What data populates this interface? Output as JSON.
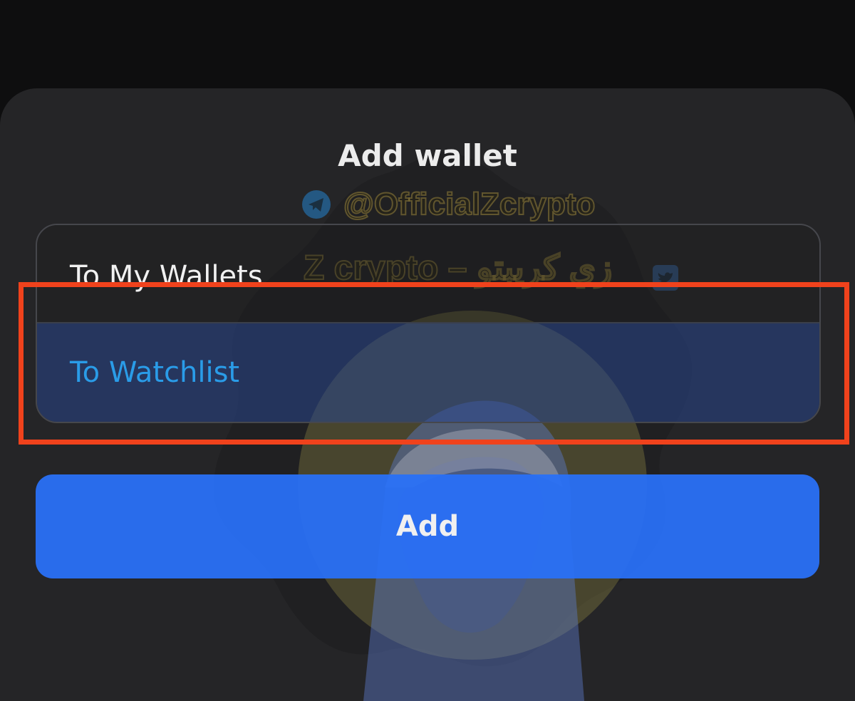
{
  "dialog": {
    "title": "Add wallet",
    "options": [
      {
        "label": "To My Wallets",
        "selected": false
      },
      {
        "label": "To Watchlist",
        "selected": true
      }
    ],
    "add_button_label": "Add"
  },
  "watermark": {
    "handle": "@OfficialZcrypto",
    "brand": "Z crypto – زي كريبتو",
    "icons": [
      "telegram-icon",
      "twitter-icon"
    ]
  },
  "colors": {
    "sheet_background": "#252527",
    "selected_option_text": "#2a9ce8",
    "add_button": "#2970f5",
    "highlight_box": "#f0421c"
  }
}
